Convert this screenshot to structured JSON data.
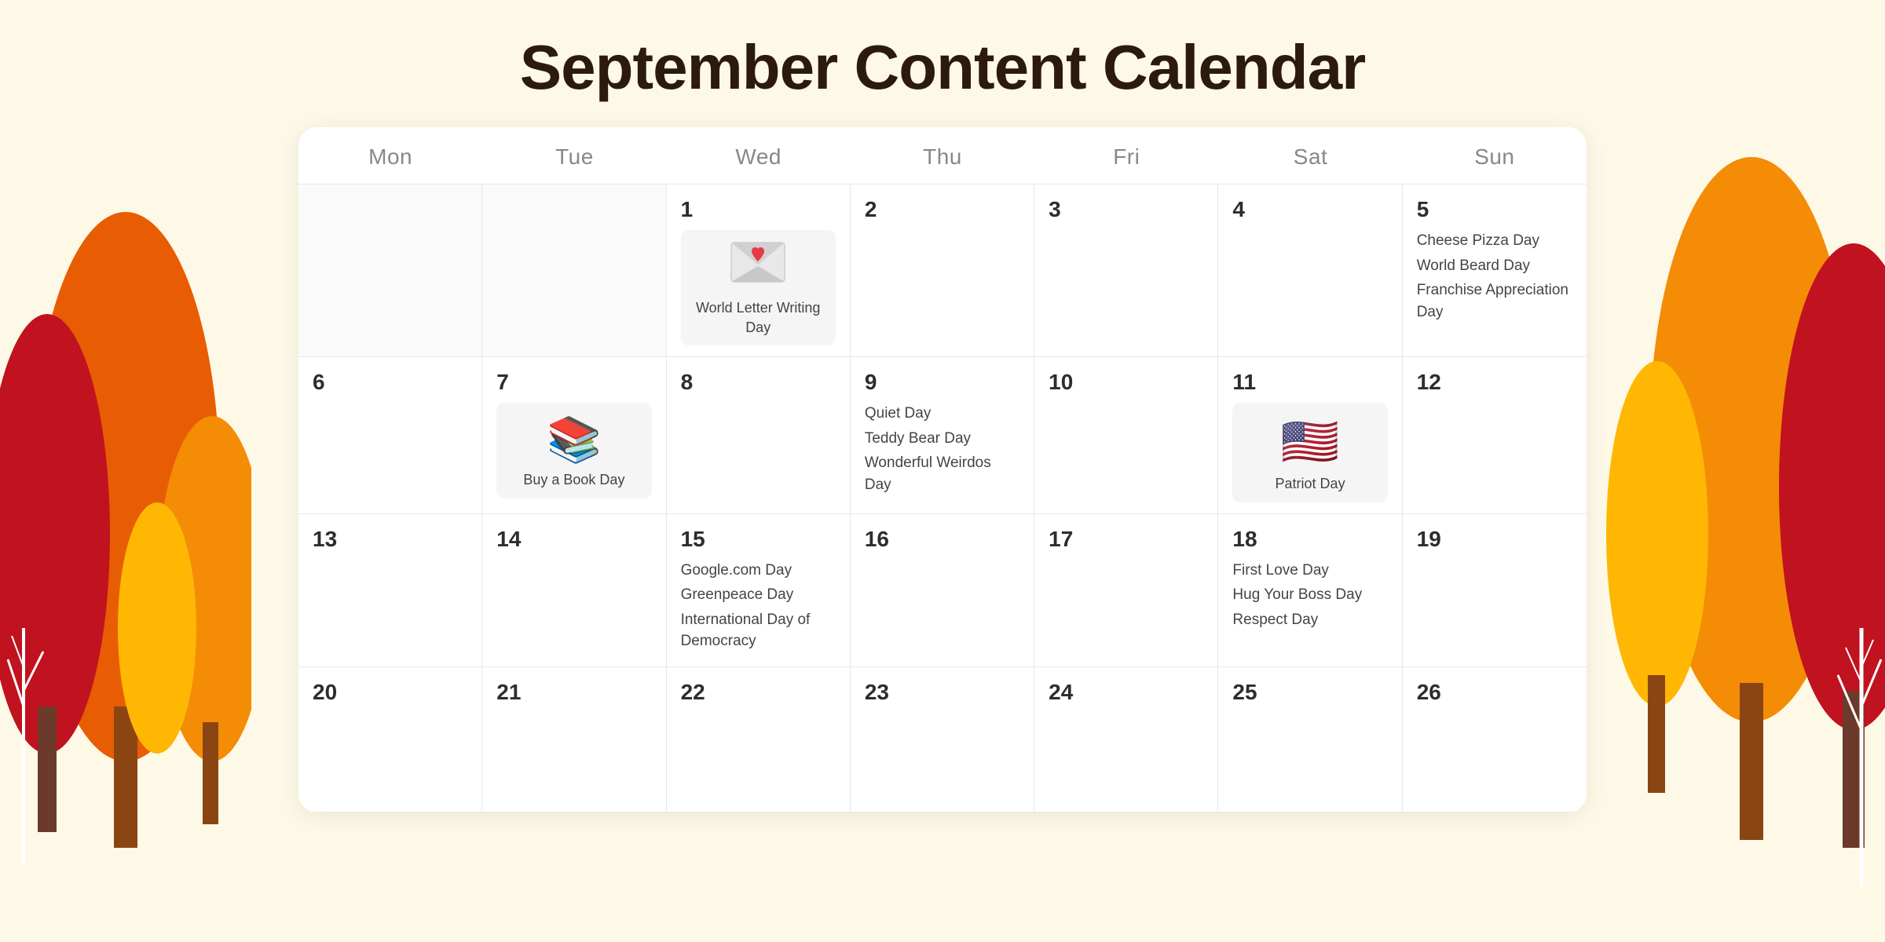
{
  "title": "September Content Calendar",
  "header": {
    "days": [
      "Mon",
      "Tue",
      "Wed",
      "Thu",
      "Fri",
      "Sat",
      "Sun"
    ]
  },
  "weeks": [
    {
      "cells": [
        {
          "num": "",
          "empty": true
        },
        {
          "num": "",
          "empty": true
        },
        {
          "num": "1",
          "icon": "✉️❤️",
          "card": true,
          "events": [
            "World Letter Writing Day"
          ]
        },
        {
          "num": "2",
          "events": []
        },
        {
          "num": "3",
          "events": []
        },
        {
          "num": "4",
          "events": []
        },
        {
          "num": "5",
          "events": [
            "Cheese Pizza Day",
            "World Beard Day",
            "Franchise Appreciation Day"
          ]
        }
      ]
    },
    {
      "cells": [
        {
          "num": "6",
          "events": []
        },
        {
          "num": "7",
          "icon": "📚",
          "card": true,
          "events": [
            "Buy a Book Day"
          ]
        },
        {
          "num": "8",
          "events": []
        },
        {
          "num": "9",
          "events": [
            "Quiet Day",
            "Teddy Bear Day",
            "Wonderful Weirdos Day"
          ]
        },
        {
          "num": "10",
          "events": []
        },
        {
          "num": "11",
          "icon": "🇺🇸",
          "card": true,
          "events": [
            "Patriot Day"
          ]
        },
        {
          "num": "12",
          "events": []
        }
      ]
    },
    {
      "cells": [
        {
          "num": "13",
          "events": []
        },
        {
          "num": "14",
          "events": []
        },
        {
          "num": "15",
          "events": [
            "Google.com Day",
            "Greenpeace Day",
            "International Day of Democracy"
          ]
        },
        {
          "num": "16",
          "events": []
        },
        {
          "num": "17",
          "events": []
        },
        {
          "num": "18",
          "events": [
            "First Love Day",
            "Hug Your Boss Day",
            "Respect Day"
          ]
        },
        {
          "num": "19",
          "events": []
        }
      ]
    },
    {
      "cells": [
        {
          "num": "20",
          "events": []
        },
        {
          "num": "21",
          "events": []
        },
        {
          "num": "22",
          "events": []
        },
        {
          "num": "23",
          "events": []
        },
        {
          "num": "24",
          "events": []
        },
        {
          "num": "25",
          "events": []
        },
        {
          "num": "26",
          "events": []
        }
      ]
    }
  ]
}
